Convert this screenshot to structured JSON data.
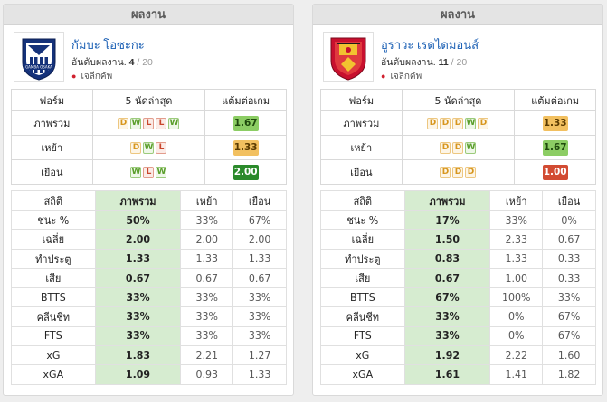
{
  "panels": [
    {
      "header": "ผลงาน",
      "team_name": "กัมบะ โอซะกะ",
      "rank_label": "อันดับผลงาน.",
      "rank": "4",
      "rank_total": "/ 20",
      "league": "เจลีกคัพ",
      "form_headers": {
        "label": "ฟอร์ม",
        "last5": "5 นัดล่าสุด",
        "ppg": "แต้มต่อเกม"
      },
      "form_rows": [
        {
          "label": "ภาพรวม",
          "results": [
            "D",
            "W",
            "L",
            "L",
            "W"
          ],
          "ppg": "1.67",
          "tone": "g"
        },
        {
          "label": "เหย้า",
          "results": [
            "D",
            "W",
            "L"
          ],
          "ppg": "1.33",
          "tone": "a"
        },
        {
          "label": "เยือน",
          "results": [
            "W",
            "L",
            "W"
          ],
          "ppg": "2.00",
          "tone": "dg"
        }
      ],
      "stats_headers": {
        "label": "สถิติ",
        "overall": "ภาพรวม",
        "home": "เหย้า",
        "away": "เยือน"
      },
      "stats_rows": [
        {
          "label": "ชนะ %",
          "overall": "50%",
          "home": "33%",
          "away": "67%"
        },
        {
          "label": "เฉลี่ย",
          "overall": "2.00",
          "home": "2.00",
          "away": "2.00"
        },
        {
          "label": "ทำประตู",
          "overall": "1.33",
          "home": "1.33",
          "away": "1.33"
        },
        {
          "label": "เสีย",
          "overall": "0.67",
          "home": "0.67",
          "away": "0.67"
        },
        {
          "label": "BTTS",
          "overall": "33%",
          "home": "33%",
          "away": "33%"
        },
        {
          "label": "คลีนชีท",
          "overall": "33%",
          "home": "33%",
          "away": "33%"
        },
        {
          "label": "FTS",
          "overall": "33%",
          "home": "33%",
          "away": "33%"
        },
        {
          "label": "xG",
          "overall": "1.83",
          "home": "2.21",
          "away": "1.27"
        },
        {
          "label": "xGA",
          "overall": "1.09",
          "home": "0.93",
          "away": "1.33"
        }
      ],
      "logo_icon": "gamba-osaka-crest-icon",
      "logo_text": "GAMBA OSAKA"
    },
    {
      "header": "ผลงาน",
      "team_name": "อูราวะ เรดไดมอนส์",
      "rank_label": "อันดับผลงาน.",
      "rank": "11",
      "rank_total": "/ 20",
      "league": "เจลีกคัพ",
      "form_headers": {
        "label": "ฟอร์ม",
        "last5": "5 นัดล่าสุด",
        "ppg": "แต้มต่อเกม"
      },
      "form_rows": [
        {
          "label": "ภาพรวม",
          "results": [
            "D",
            "D",
            "D",
            "W",
            "D"
          ],
          "ppg": "1.33",
          "tone": "a"
        },
        {
          "label": "เหย้า",
          "results": [
            "D",
            "D",
            "W"
          ],
          "ppg": "1.67",
          "tone": "g"
        },
        {
          "label": "เยือน",
          "results": [
            "D",
            "D",
            "D"
          ],
          "ppg": "1.00",
          "tone": "r"
        }
      ],
      "stats_headers": {
        "label": "สถิติ",
        "overall": "ภาพรวม",
        "home": "เหย้า",
        "away": "เยือน"
      },
      "stats_rows": [
        {
          "label": "ชนะ %",
          "overall": "17%",
          "home": "33%",
          "away": "0%"
        },
        {
          "label": "เฉลี่ย",
          "overall": "1.50",
          "home": "2.33",
          "away": "0.67"
        },
        {
          "label": "ทำประตู",
          "overall": "0.83",
          "home": "1.33",
          "away": "0.33"
        },
        {
          "label": "เสีย",
          "overall": "0.67",
          "home": "1.00",
          "away": "0.33"
        },
        {
          "label": "BTTS",
          "overall": "67%",
          "home": "100%",
          "away": "33%"
        },
        {
          "label": "คลีนชีท",
          "overall": "33%",
          "home": "0%",
          "away": "67%"
        },
        {
          "label": "FTS",
          "overall": "33%",
          "home": "0%",
          "away": "67%"
        },
        {
          "label": "xG",
          "overall": "1.92",
          "home": "2.22",
          "away": "1.60"
        },
        {
          "label": "xGA",
          "overall": "1.61",
          "home": "1.41",
          "away": "1.82"
        }
      ],
      "logo_icon": "urawa-red-diamonds-crest-icon"
    }
  ],
  "colors": {
    "win": "#5a9e2b",
    "draw": "#d7961e",
    "loss": "#c9462c",
    "overall_col_bg": "#d6ecd0",
    "team_link": "#1a5fb4",
    "panel_header_bg": "#e4e4e4"
  }
}
